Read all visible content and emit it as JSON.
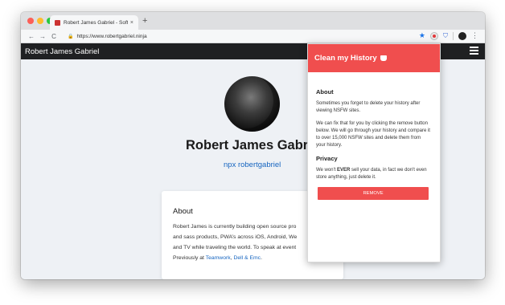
{
  "browser": {
    "tab_title": "Robert James Gabriel - Softw",
    "tab_close": "×",
    "new_tab": "+",
    "url": "https://www.robertgabriel.ninja",
    "nav": {
      "back": "←",
      "forward": "→",
      "reload": "C"
    },
    "lock": "🔒",
    "star": "★",
    "menu": "⋮",
    "shield": "⛉"
  },
  "site": {
    "brand": "Robert James Gabriel",
    "name": "Robert James Gabri",
    "npx": "npx robertgabriel",
    "about": {
      "title": "About",
      "line1": "Robert James is currently building open source pro",
      "line2": "and sass products, PWA’s across iOS, Android, We",
      "line3": "and TV while traveling the world. To speak at event",
      "line4_prefix": "Previously at ",
      "link_teamwork": "Teamwork",
      "comma": ", ",
      "link_dell": "Dell & Emc",
      "period": "."
    }
  },
  "extension": {
    "title": "Clean my History",
    "about_heading": "About",
    "about_p1": "Sometimes you forget to delete your history after viewing NSFW sites.",
    "about_p2": "We can fix that for you by clicking the remove button below. We will go through your history and compare it to over 15,000 NSFW sites and delete them from your history.",
    "privacy_heading": "Privacy",
    "privacy_prefix": "We won't ",
    "privacy_bold": "EVER",
    "privacy_suffix": " sell your data, in fact we don't even store anything, just delete it.",
    "remove_label": "REMOVE",
    "accent_color": "#f04e4e"
  }
}
